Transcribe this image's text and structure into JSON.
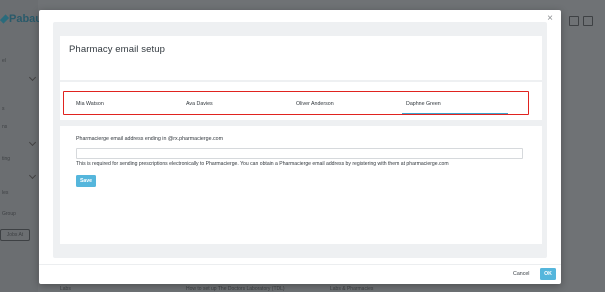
{
  "background": {
    "logo_text": "Pabau",
    "side_items": [
      "el",
      "",
      "s",
      "ns",
      "",
      "ting",
      "",
      "les",
      "Group"
    ],
    "side_button": "Jobs At",
    "bottom_items": [
      "Labs",
      "How to set up The Doctors Laboratory (TDL)",
      "Labs & Pharmacies"
    ]
  },
  "modal": {
    "title": "Pharmacy email setup",
    "close_label": "×",
    "tabs": [
      {
        "label": "Mia Watson"
      },
      {
        "label": "Ava Davies"
      },
      {
        "label": "Oliver Anderson"
      },
      {
        "label": "Daphne Green"
      }
    ],
    "active_tab_index": 3,
    "form": {
      "email_label": "Pharmacierge email address ending in @rx.pharmacierge.com",
      "email_value": "",
      "help_text": "This is required for sending prescriptions electronically to Pharmacierge. You can obtain a Pharmacierge email address by registering with them at pharmacierge.com",
      "save_label": "Save"
    },
    "footer": {
      "cancel_label": "Cancel",
      "ok_label": "OK"
    }
  },
  "colors": {
    "accent": "#55b6dc",
    "highlight_border": "#e0231f",
    "overlay": "#6f7275"
  }
}
